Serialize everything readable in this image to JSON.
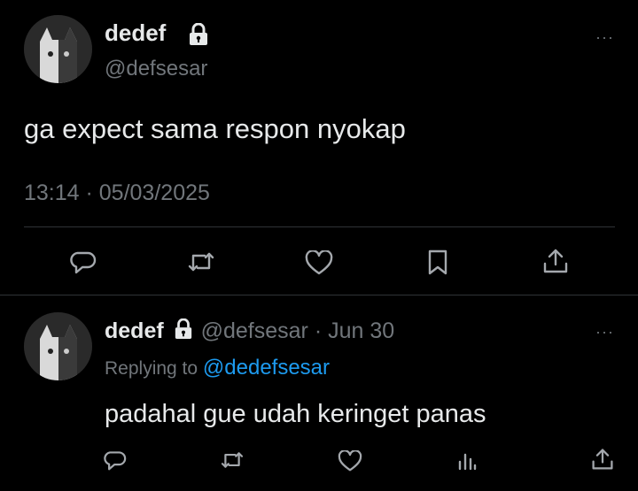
{
  "main_tweet": {
    "display_name": "dedef",
    "handle": "@defsesar",
    "text": "ga expect sama respon nyokap",
    "timestamp": "13:14 · 05/03/2025",
    "more_label": "···",
    "icons": [
      "reply-icon",
      "retweet-icon",
      "like-icon",
      "bookmark-icon",
      "share-icon"
    ]
  },
  "reply_tweet": {
    "display_name": "dedef",
    "handle": "@defsesar",
    "separator": "·",
    "date": "Jun 30",
    "replying_prefix": "Replying to",
    "replying_to": "@dedefsesar",
    "text": "padahal gue udah keringet panas",
    "more_label": "···",
    "icons": [
      "reply-icon",
      "retweet-icon",
      "like-icon",
      "views-icon",
      "share-icon"
    ]
  },
  "colors": {
    "background": "#000000",
    "text": "#e7e9ea",
    "muted": "#71767b",
    "link": "#1d9bf0",
    "divider": "#2f3336"
  }
}
